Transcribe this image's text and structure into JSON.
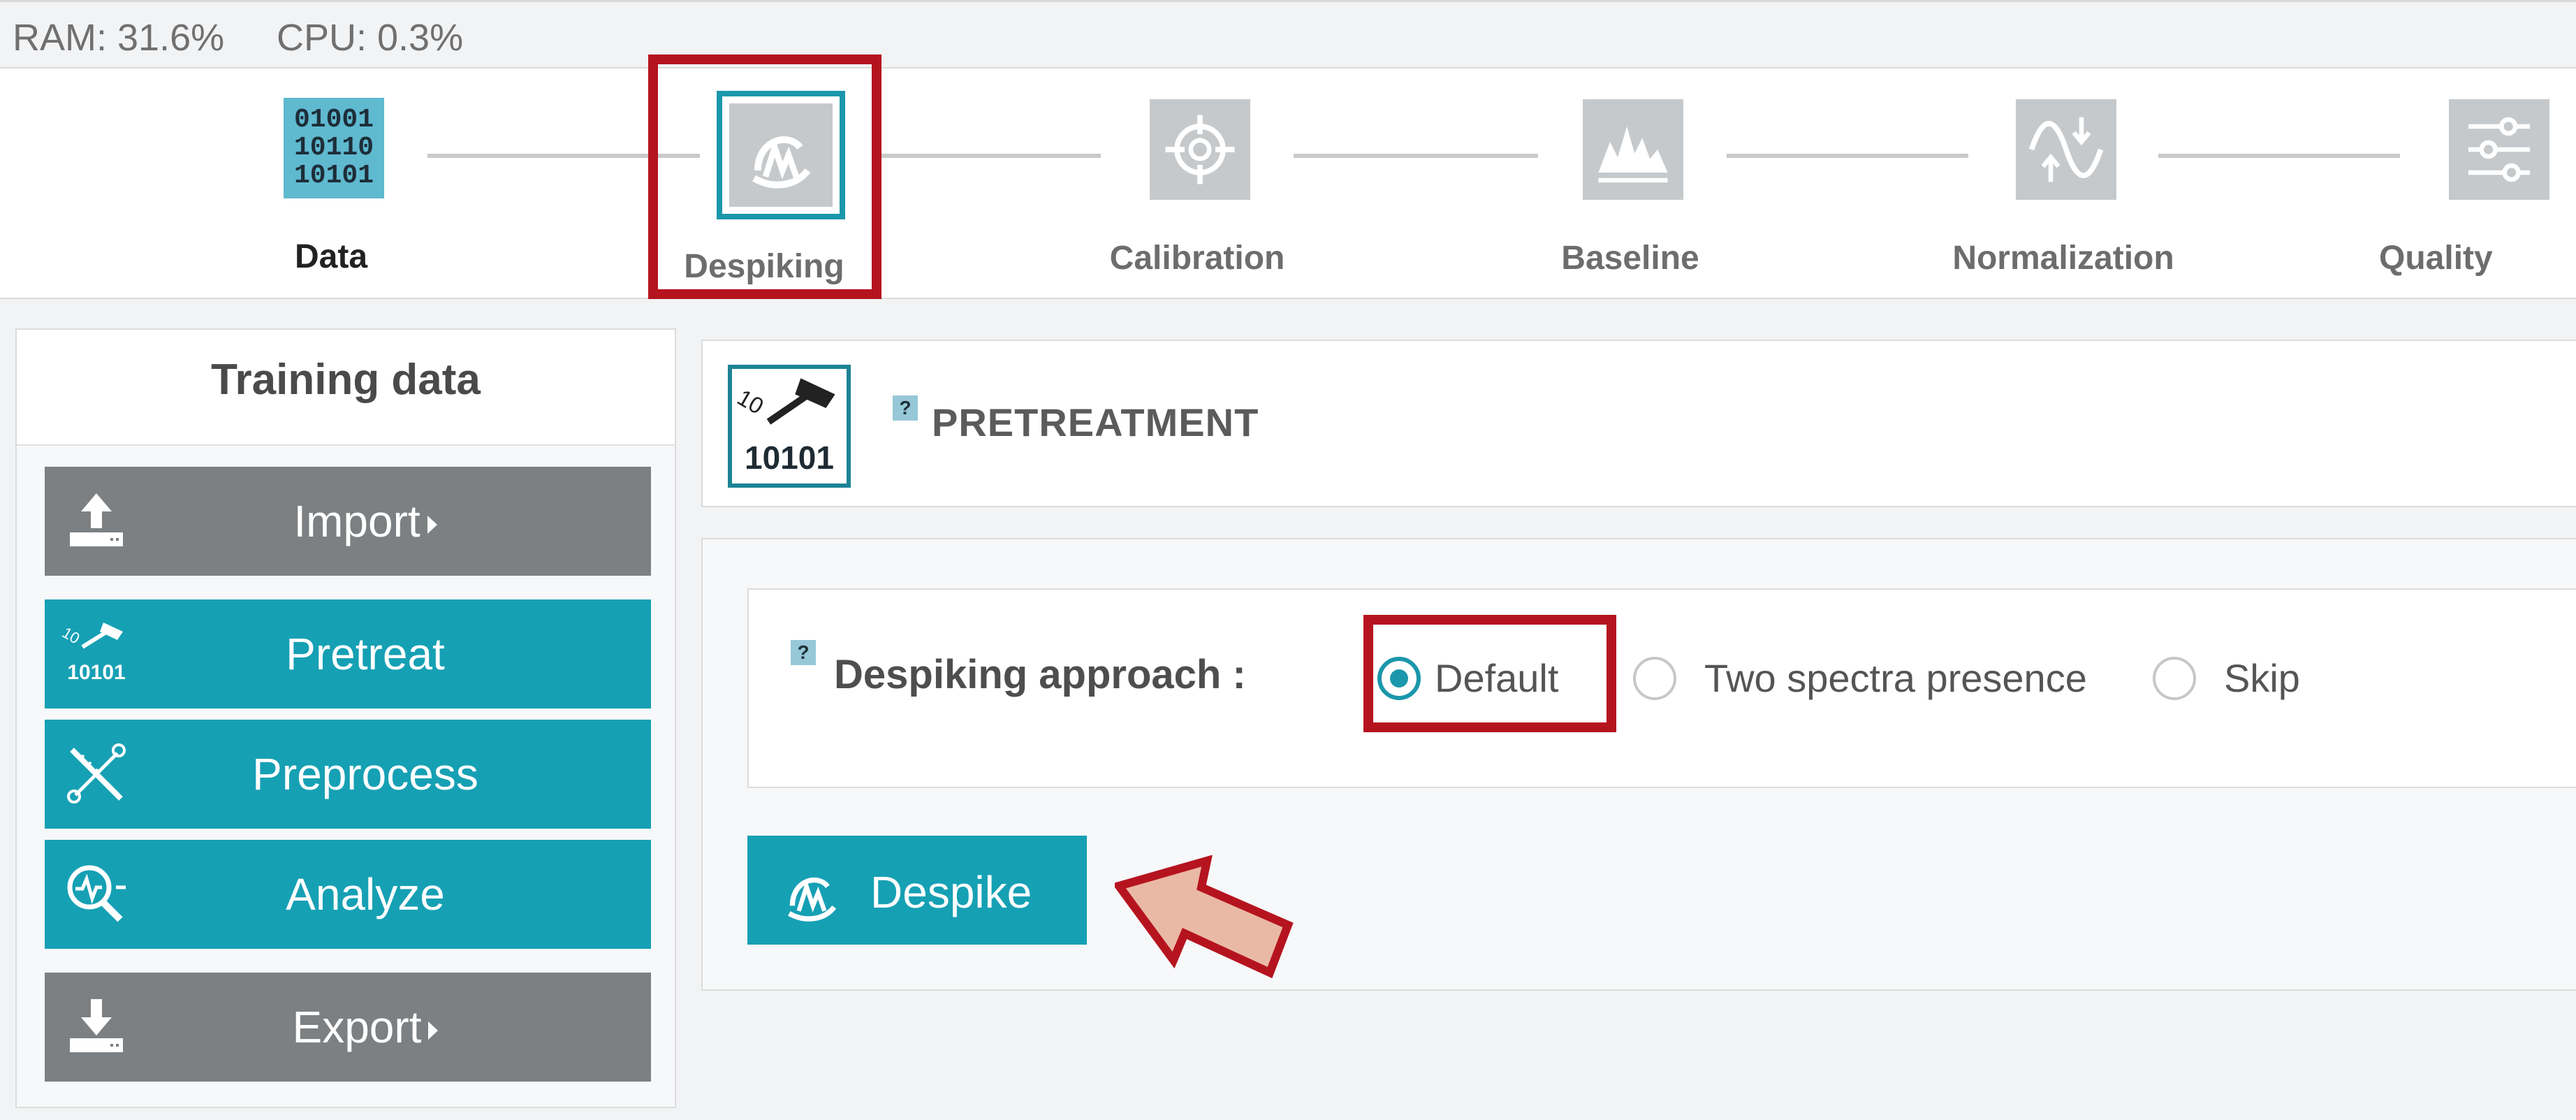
{
  "status": {
    "ram": "RAM: 31.6%",
    "cpu": "CPU: 0.3%"
  },
  "workflow": {
    "steps": [
      {
        "label": "Data",
        "icon": "binary-data-icon",
        "active": false
      },
      {
        "label": "Despiking",
        "icon": "despiking-icon",
        "active": true
      },
      {
        "label": "Calibration",
        "icon": "crosshair-target-icon",
        "active": false
      },
      {
        "label": "Baseline",
        "icon": "spectrum-baseline-icon",
        "active": false
      },
      {
        "label": "Normalization",
        "icon": "sine-wave-normalize-icon",
        "active": false
      },
      {
        "label": "Quality",
        "icon": "sliders-icon",
        "active": false
      }
    ],
    "data_icon_text": "01001\n10110\n10101"
  },
  "left_panel": {
    "title": "Training data",
    "buttons": [
      {
        "label": "Import",
        "icon": "upload-icon",
        "style": "gray",
        "has_caret": true
      },
      {
        "label": "Pretreat",
        "icon": "pretreat-hammer-icon",
        "style": "teal",
        "has_caret": false
      },
      {
        "label": "Preprocess",
        "icon": "preprocess-tools-icon",
        "style": "teal",
        "has_caret": false
      },
      {
        "label": "Analyze",
        "icon": "analyze-magnifier-icon",
        "style": "teal",
        "has_caret": false
      },
      {
        "label": "Export",
        "icon": "download-icon",
        "style": "gray",
        "has_caret": true
      }
    ],
    "pretreat_icon_text": "10101"
  },
  "pretreatment": {
    "help": "?",
    "title": "PRETREATMENT",
    "icon_text": "10101"
  },
  "despiking": {
    "help": "?",
    "approach_label": "Despiking approach :",
    "options": [
      {
        "label": "Default",
        "selected": true
      },
      {
        "label": "Two spectra presence",
        "selected": false
      },
      {
        "label": "Skip",
        "selected": false
      }
    ],
    "button_label": "Despike"
  },
  "colors": {
    "teal": "#16a0b4",
    "gray_button": "#7d8082",
    "highlight_red": "#b5141f",
    "arrow_fill": "#eab9a5"
  }
}
